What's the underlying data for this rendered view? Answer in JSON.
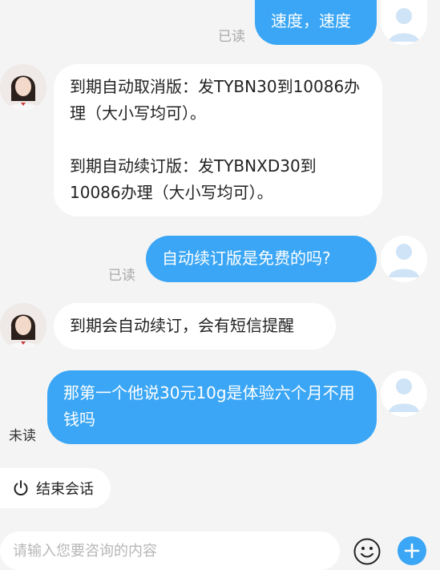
{
  "messages": [
    {
      "side": "out",
      "text": "速度，速度",
      "status": "已读"
    },
    {
      "side": "in",
      "paragraphs": [
        "到期自动取消版：发TYBN30到10086办理（大小写均可）。",
        "到期自动续订版：发TYBNXD30到10086办理（大小写均可）。"
      ]
    },
    {
      "side": "out",
      "text": "自动续订版是免费的吗?",
      "status": "已读"
    },
    {
      "side": "in",
      "text": "到期会自动续订，会有短信提醒"
    },
    {
      "side": "out",
      "text": "那第一个他说30元10g是体验六个月不用钱吗",
      "status": "未读"
    }
  ],
  "end_session": {
    "label": "结束会话",
    "icon": "power-icon"
  },
  "input": {
    "placeholder": "请输入您要咨询的内容",
    "value": ""
  },
  "icons": {
    "emoji": "emoji-icon",
    "add": "plus-icon"
  },
  "colors": {
    "accent": "#3aa6f5",
    "background": "#f4f4f4",
    "bubble_in": "#ffffff"
  }
}
